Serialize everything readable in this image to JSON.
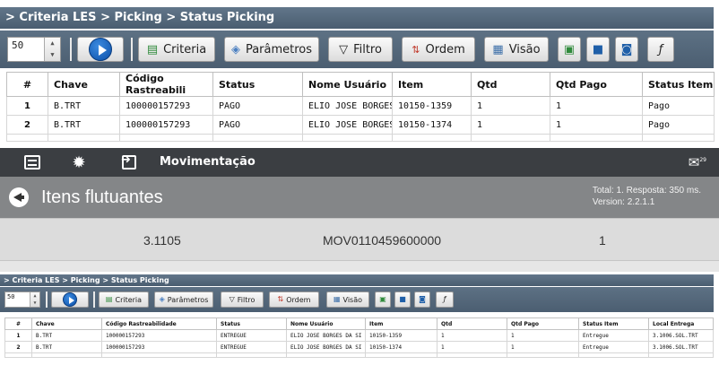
{
  "panel_a": {
    "breadcrumb": "> Criteria LES > Picking > Status Picking",
    "toolbar": {
      "page_size": "50",
      "criteria": "Criteria",
      "parametros": "Parâmetros",
      "filtro": "Filtro",
      "ordem": "Ordem",
      "visao": "Visão"
    },
    "table": {
      "headers": [
        "#",
        "Chave",
        "Código Rastreabili",
        "Status",
        "Nome Usuário",
        "Item",
        "Qtd",
        "Qtd Pago",
        "Status Item"
      ],
      "rows": [
        [
          "1",
          "B.TRT",
          "100000157293",
          "PAGO",
          "ELIO JOSE BORGES",
          "10150-1359",
          "1",
          "1",
          "Pago"
        ],
        [
          "2",
          "B.TRT",
          "100000157293",
          "PAGO",
          "ELIO JOSE BORGES",
          "10150-1374",
          "1",
          "1",
          "Pago"
        ]
      ]
    }
  },
  "panel_b": {
    "app_title": "Movimentação",
    "notification_count": "29",
    "page_title": "Itens flutuantes",
    "status_line": "Total: 1. Resposta: 350 ms.",
    "version_line": "Version: 2.2.1.1",
    "item": {
      "code": "3.1105",
      "movement": "MOV0110459600000",
      "quantity": "1"
    }
  },
  "panel_c": {
    "breadcrumb": "> Criteria LES > Picking > Status Picking",
    "toolbar": {
      "page_size": "50",
      "criteria": "Criteria",
      "parametros": "Parâmetros",
      "filtro": "Filtro",
      "ordem": "Ordem",
      "visao": "Visão"
    },
    "table": {
      "headers": [
        "#",
        "Chave",
        "Código Rastreabilidade",
        "Status",
        "Nome Usuário",
        "Item",
        "Qtd",
        "Qtd Pago",
        "Status Item",
        "Local Entrega"
      ],
      "rows": [
        [
          "1",
          "B.TRT",
          "100000157293",
          "ENTREGUE",
          "ELIO JOSE BORGES DA SI",
          "10150-1359",
          "1",
          "1",
          "Entregue",
          "3.1006.SOL.TRT"
        ],
        [
          "2",
          "B.TRT",
          "100000157293",
          "ENTREGUE",
          "ELIO JOSE BORGES DA SI",
          "10150-1374",
          "1",
          "1",
          "Entregue",
          "3.1006.SOL.TRT"
        ]
      ]
    }
  },
  "colors": {
    "toolbar_blue": "#52667a",
    "dark_appbar": "#3b3e42",
    "header_gray": "#848688"
  }
}
